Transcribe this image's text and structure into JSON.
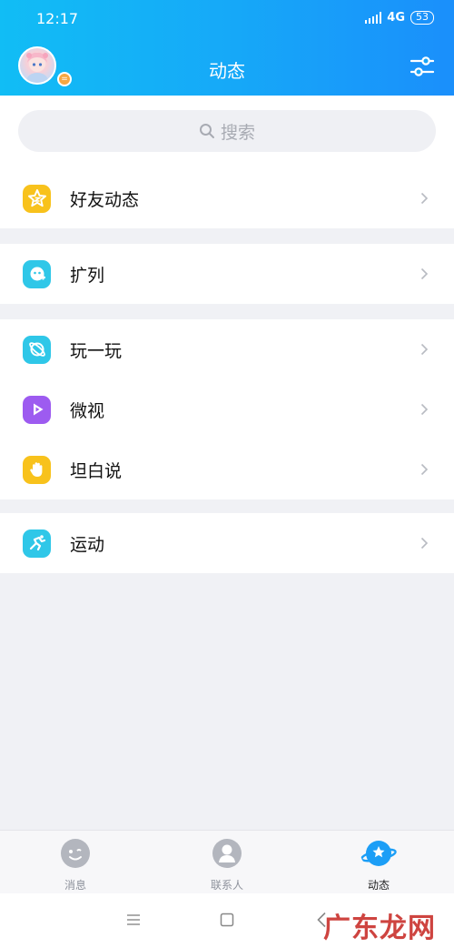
{
  "status_bar": {
    "time": "12:17",
    "network": "4G",
    "battery": "53"
  },
  "header": {
    "title": "动态",
    "avatar_badge": "="
  },
  "search": {
    "placeholder": "搜索"
  },
  "groups": [
    {
      "items": [
        {
          "label": "好友动态",
          "icon": "star-icon",
          "color": "#f8c21c"
        }
      ]
    },
    {
      "items": [
        {
          "label": "扩列",
          "icon": "planet-face-icon",
          "color": "#2fc7e8"
        }
      ]
    },
    {
      "items": [
        {
          "label": "玩一玩",
          "icon": "planet-ring-icon",
          "color": "#2fc7e8"
        },
        {
          "label": "微视",
          "icon": "play-icon",
          "color": "#9d5bf0"
        },
        {
          "label": "坦白说",
          "icon": "hand-icon",
          "color": "#f8c21c"
        }
      ]
    },
    {
      "items": [
        {
          "label": "运动",
          "icon": "run-icon",
          "color": "#2fc7e8"
        }
      ]
    }
  ],
  "tabbar": {
    "tabs": [
      {
        "label": "消息",
        "icon": "message-icon"
      },
      {
        "label": "联系人",
        "icon": "contact-icon"
      },
      {
        "label": "动态",
        "icon": "planet-icon",
        "active": true
      }
    ]
  },
  "watermark": "广东龙网"
}
